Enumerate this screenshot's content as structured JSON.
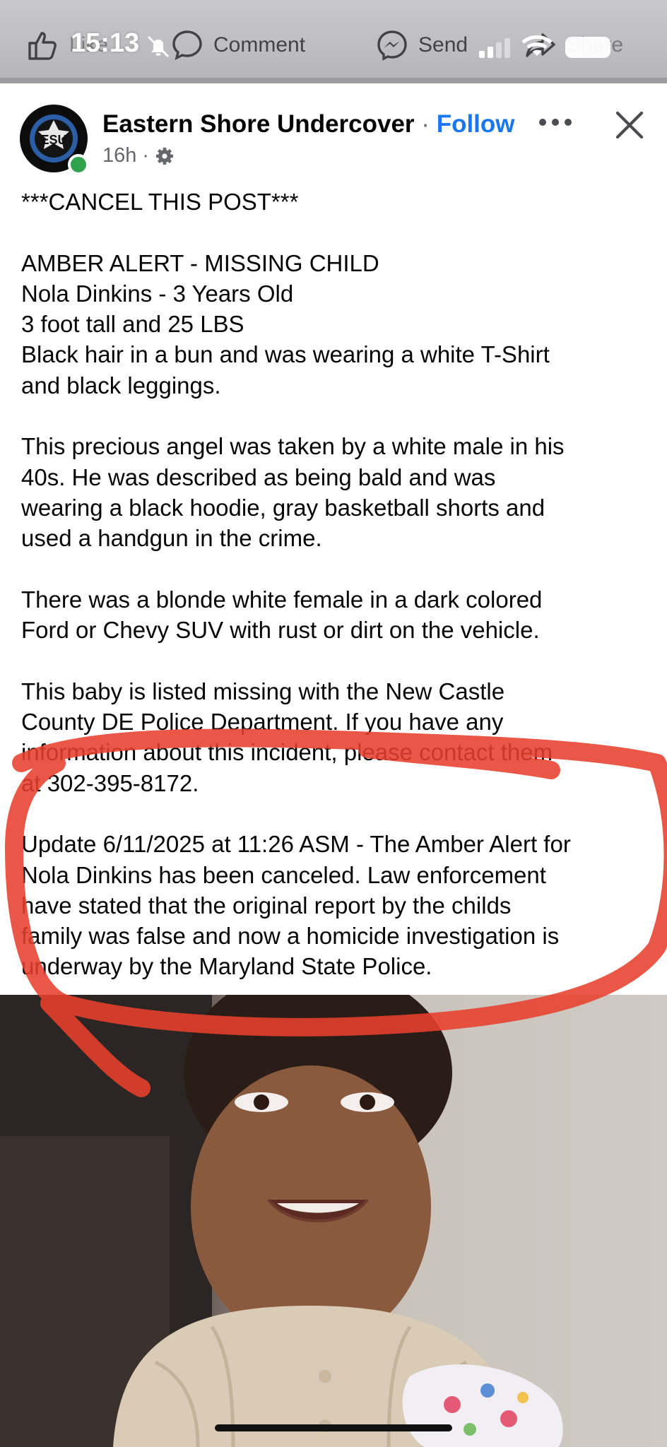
{
  "status_bar": {
    "time": "15:13"
  },
  "action_bar": {
    "like_label": "Like",
    "comment_label": "Comment",
    "send_label": "Send",
    "share_label": "Share"
  },
  "post": {
    "page_name": "Eastern Shore Undercover",
    "separator": "·",
    "follow_label": "Follow",
    "time_ago": "16h",
    "time_separator": "·",
    "avatar_initials": "ESU",
    "avatar_ring_text": "EASTERN SHORE UNDERCOVER",
    "paragraphs": [
      "***CANCEL THIS POST***",
      "AMBER ALERT - MISSING CHILD\nNola Dinkins - 3 Years Old\n3 foot tall and 25 LBS\nBlack hair in a bun and was wearing a white T-Shirt\nand black leggings.",
      "This precious angel was taken by a white male in his\n40s. He was described as being bald and was\nwearing a black hoodie, gray basketball shorts and\nused a handgun in the crime.",
      "There was a blonde white female in a dark colored\nFord or Chevy SUV with rust or dirt on the vehicle.",
      "This baby is listed missing with the New Castle\nCounty DE Police Department. If you have any\ninformation about this incident, please contact them\nat 302-395-8172.",
      "Update 6/11/2025 at 11:26 ASM - The Amber Alert for\nNola Dinkins has been canceled. Law enforcement\nhave stated that the original report by the childs\nfamily was false and now a homicide investigation is\nunderway by the Maryland State Police."
    ]
  },
  "icons": [
    "like-icon",
    "comment-icon",
    "send-icon",
    "share-icon",
    "bell-slash-icon",
    "signal-icon",
    "wifi-icon",
    "battery-icon",
    "gear-icon",
    "more-icon",
    "close-icon"
  ],
  "colors": {
    "follow": "#1877f2",
    "annotation": "#e8402c",
    "online": "#31a24c"
  }
}
